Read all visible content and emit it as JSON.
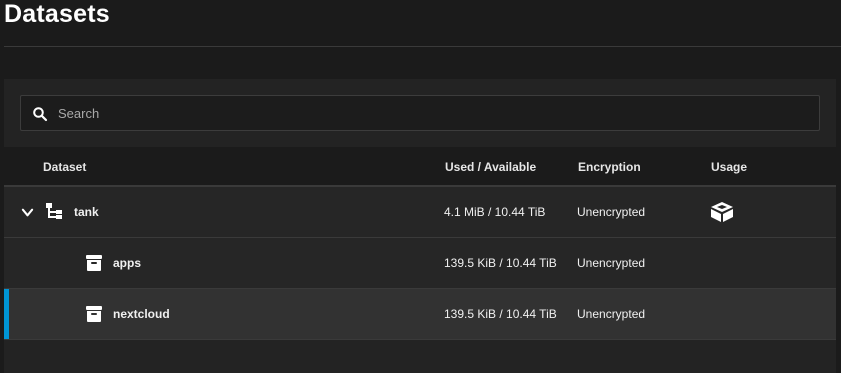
{
  "page": {
    "title": "Datasets"
  },
  "search": {
    "placeholder": "Search",
    "value": ""
  },
  "table": {
    "columns": {
      "dataset": "Dataset",
      "used_available": "Used / Available",
      "encryption": "Encryption",
      "usage": "Usage"
    },
    "rows": [
      {
        "name": "tank",
        "used_available": "4.1 MiB / 10.44 TiB",
        "encryption": "Unencrypted",
        "icon": "dataset-tree-icon",
        "usage_icon": "usage-box-icon",
        "expanded": true
      },
      {
        "name": "apps",
        "used_available": "139.5 KiB / 10.44 TiB",
        "encryption": "Unencrypted",
        "icon": "archive-icon"
      },
      {
        "name": "nextcloud",
        "used_available": "139.5 KiB / 10.44 TiB",
        "encryption": "Unencrypted",
        "icon": "archive-icon",
        "selected": true
      }
    ]
  },
  "colors": {
    "accent": "#0095d5",
    "background": "#1b1b1b",
    "panel": "#232323",
    "selected_row": "#323232"
  }
}
